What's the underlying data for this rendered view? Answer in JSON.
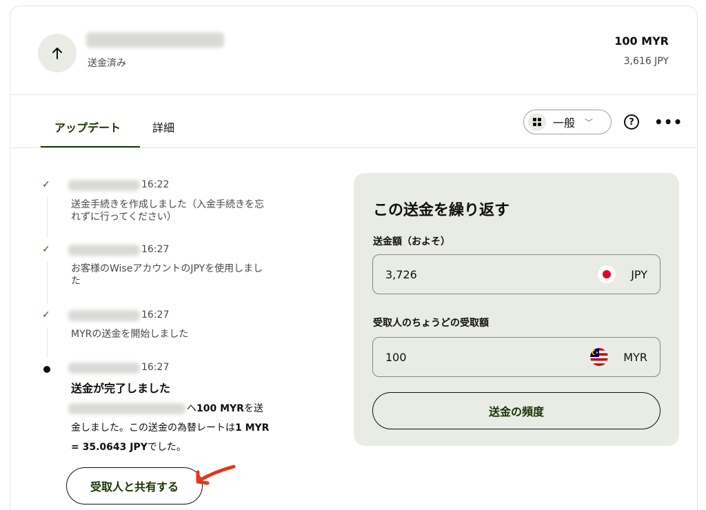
{
  "header": {
    "status": "送金済み",
    "amount": "100 MYR",
    "sub_amount": "3,616 JPY"
  },
  "tabs": [
    {
      "label": "アップデート",
      "active": true
    },
    {
      "label": "詳細",
      "active": false
    }
  ],
  "filter": {
    "label": "一般"
  },
  "timeline": [
    {
      "time": "16:22",
      "text": "送金手続きを作成しました（入金手続きを忘れずに行ってください）"
    },
    {
      "time": "16:27",
      "text": "お客様のWiseアカウントのJPYを使用しました"
    },
    {
      "time": "16:27",
      "text": "MYRの送金を開始しました"
    },
    {
      "time": "16:27",
      "title": "送金が完了しました",
      "desc_a": "へ",
      "desc_amount": "100 MYR",
      "desc_b": "を送金しました。この送金の為替レートは",
      "desc_rate": "1 MYR = 35.0643 JPY",
      "desc_c": "でした。"
    }
  ],
  "share_button": "受取人と共有する",
  "repeat": {
    "title": "この送金を繰り返す",
    "send_label": "送金額（およそ）",
    "send_value": "3,726",
    "send_currency": "JPY",
    "recv_label": "受取人のちょうどの受取額",
    "recv_value": "100",
    "recv_currency": "MYR",
    "frequency_button": "送金の頻度"
  },
  "colors": {
    "accent": "#163300",
    "panel": "#e9ebe5",
    "annotation_arrow": "#e8341c"
  }
}
